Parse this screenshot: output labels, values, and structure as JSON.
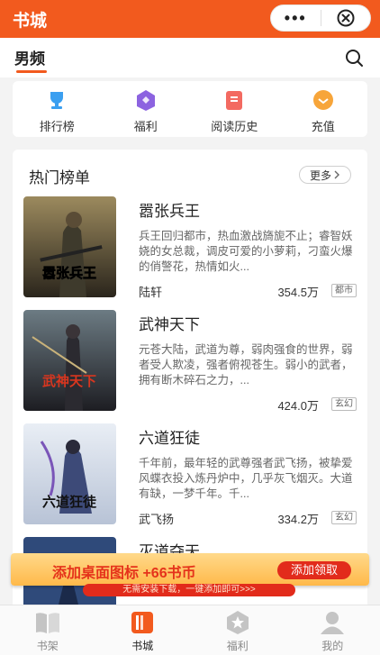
{
  "header": {
    "title": "书城",
    "more_label": "•••"
  },
  "tabs": {
    "active": "男频"
  },
  "shortcuts": [
    {
      "label": "排行榜",
      "icon": "trophy-icon",
      "color": "#3b9ff0"
    },
    {
      "label": "福利",
      "icon": "gift-icon",
      "color": "#8c63e0"
    },
    {
      "label": "阅读历史",
      "icon": "history-icon",
      "color": "#f36a61"
    },
    {
      "label": "充值",
      "icon": "coin-icon",
      "color": "#f7a53a"
    }
  ],
  "hot": {
    "title": "热门榜单",
    "more_label": "更多",
    "books": [
      {
        "title": "嚣张兵王",
        "desc": "兵王回归都市，热血激战旖旎不止；睿智妖娆的女总裁，调皮可爱的小萝莉，刁蛮火爆的俏警花，热情如火...",
        "author": "陆轩",
        "count": "354.5万",
        "tag": "都市",
        "cover_text": "嚣张兵王"
      },
      {
        "title": "武神天下",
        "desc": "元苍大陆，武道为尊，弱肉强食的世界，弱者受人欺凌，强者俯视苍生。弱小的武者，拥有断木碎石之力，...",
        "author": "",
        "count": "424.0万",
        "tag": "玄幻",
        "cover_text": "武神天下"
      },
      {
        "title": "六道狂徒",
        "desc": "千年前，最年轻的武尊强者武飞扬，被挚爱风蝶衣投入炼丹炉中，几乎灰飞烟灭。大道有缺，一梦千年。千...",
        "author": "武飞扬",
        "count": "334.2万",
        "tag": "玄幻",
        "cover_text": "六道狂徒"
      },
      {
        "title": "灭道夺天",
        "desc": "",
        "author": "",
        "count": "",
        "tag": "",
        "cover_text": ""
      }
    ]
  },
  "promo": {
    "text": "添加桌面图标 +66书币",
    "button": "添加领取",
    "subtext": "无需安装下载，一键添加即可>>>"
  },
  "bottom_nav": [
    {
      "label": "书架",
      "icon": "bookshelf-icon"
    },
    {
      "label": "书城",
      "icon": "bookstore-icon",
      "active": true
    },
    {
      "label": "福利",
      "icon": "star-icon"
    },
    {
      "label": "我的",
      "icon": "profile-icon"
    }
  ],
  "colors": {
    "brand": "#f25a1e",
    "promo_red": "#e22b1b"
  }
}
